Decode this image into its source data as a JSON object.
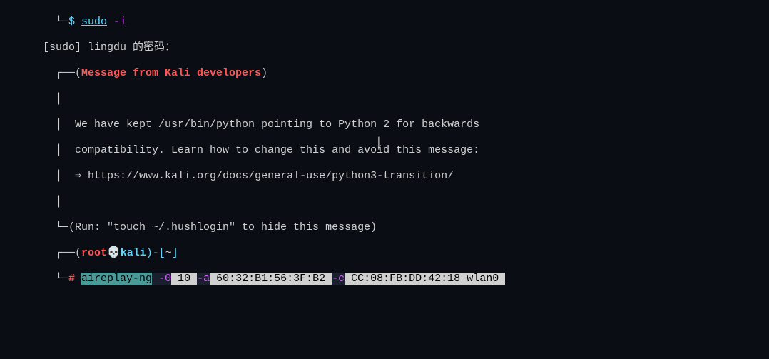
{
  "prompt1": {
    "tree": "  └─",
    "dollar": "$ ",
    "cmd": "sudo",
    "flag": " -i"
  },
  "sudo_pw": "[sudo] lingdu 的密码：",
  "msg_box": {
    "top": "  ┌──(",
    "title": "Message from Kali developers",
    "close": ")",
    "body_line1": "  │",
    "body_line2": "  │  We have kept /usr/bin/python pointing to Python 2 for backwards",
    "body_line3": "  │  compatibility. Learn how to change this and avoid this message:",
    "body_line4": "  │  ⇒ https://www.kali.org/docs/general-use/python3-transition/",
    "body_line5": "  │",
    "bottom": "  └─(Run: \"touch ~/.hushlogin\" to hide this message)"
  },
  "prompt2": {
    "tree_top": "  ┌──(",
    "user": "root",
    "skull": "💀",
    "host": "kali",
    "close_paren": ")",
    "dash": "-",
    "bracket_open": "[",
    "path": "~",
    "bracket_close": "]",
    "tree_bottom": "  └─",
    "hash": "# "
  },
  "command": {
    "cmd": "aireplay-ng",
    "flag0": " -0",
    "arg0": " 10 ",
    "flaga": "-a",
    "arga": " 60:32:B1:56:3F:B2 ",
    "flagc": "-c",
    "argc": " CC:08:FB:DD:42:18",
    "iface": " wlan0 "
  },
  "cursor": "I"
}
